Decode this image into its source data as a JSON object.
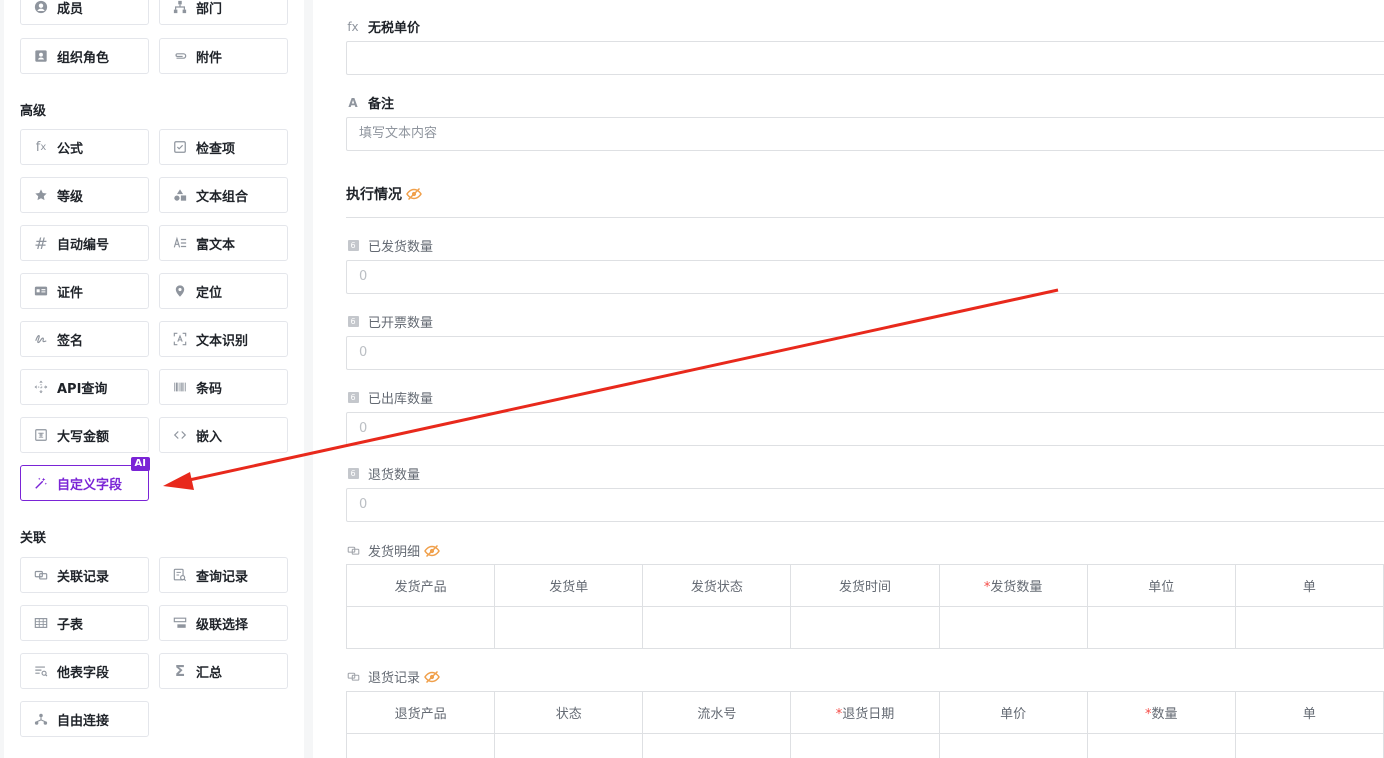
{
  "palette": {
    "top_fields": [
      {
        "label": "成员",
        "icon": "user-circle-icon"
      },
      {
        "label": "部门",
        "icon": "org-tree-icon"
      },
      {
        "label": "组织角色",
        "icon": "role-card-icon"
      },
      {
        "label": "附件",
        "icon": "paperclip-icon"
      }
    ],
    "advanced": {
      "title": "高级",
      "fields": [
        {
          "label": "公式",
          "icon": "fx-icon"
        },
        {
          "label": "检查项",
          "icon": "checkbox-icon"
        },
        {
          "label": "等级",
          "icon": "star-icon"
        },
        {
          "label": "文本组合",
          "icon": "shapes-icon"
        },
        {
          "label": "自动编号",
          "icon": "hash-icon"
        },
        {
          "label": "富文本",
          "icon": "rich-text-icon"
        },
        {
          "label": "证件",
          "icon": "id-card-icon"
        },
        {
          "label": "定位",
          "icon": "location-pin-icon"
        },
        {
          "label": "签名",
          "icon": "signature-icon"
        },
        {
          "label": "文本识别",
          "icon": "ocr-scan-icon"
        },
        {
          "label": "API查询",
          "icon": "api-move-icon"
        },
        {
          "label": "条码",
          "icon": "barcode-icon"
        },
        {
          "label": "大写金额",
          "icon": "currency-icon"
        },
        {
          "label": "嵌入",
          "icon": "code-brackets-icon"
        },
        {
          "label": "自定义字段",
          "icon": "magic-wand-icon",
          "badge": "AI"
        }
      ]
    },
    "relation": {
      "title": "关联",
      "fields": [
        {
          "label": "关联记录",
          "icon": "link-record-icon"
        },
        {
          "label": "查询记录",
          "icon": "query-record-icon"
        },
        {
          "label": "子表",
          "icon": "sub-table-icon"
        },
        {
          "label": "级联选择",
          "icon": "cascade-icon"
        },
        {
          "label": "他表字段",
          "icon": "other-table-field-icon"
        },
        {
          "label": "汇总",
          "icon": "sigma-icon"
        },
        {
          "label": "自由连接",
          "icon": "free-connect-icon"
        }
      ]
    }
  },
  "form": {
    "price_field": {
      "icon_text": "fx",
      "label": "无税单价",
      "value": ""
    },
    "note_field": {
      "icon_text": "A",
      "label": "备注",
      "placeholder": "填写文本内容"
    },
    "section": {
      "title": "执行情况"
    },
    "number_fields": [
      {
        "label": "已发货数量",
        "value": "0"
      },
      {
        "label": "已开票数量",
        "value": "0"
      },
      {
        "label": "已出库数量",
        "value": "0"
      },
      {
        "label": "退货数量",
        "value": "0"
      }
    ],
    "number_icon_text": "6",
    "shipping_table": {
      "label": "发货明细",
      "columns": [
        {
          "label": "发货产品",
          "required": false
        },
        {
          "label": "发货单",
          "required": false
        },
        {
          "label": "发货状态",
          "required": false
        },
        {
          "label": "发货时间",
          "required": false
        },
        {
          "label": "发货数量",
          "required": true
        },
        {
          "label": "单位",
          "required": false
        },
        {
          "label": "单",
          "required": false
        }
      ]
    },
    "return_table": {
      "label": "退货记录",
      "columns": [
        {
          "label": "退货产品",
          "required": false
        },
        {
          "label": "状态",
          "required": false
        },
        {
          "label": "流水号",
          "required": false
        },
        {
          "label": "退货日期",
          "required": true
        },
        {
          "label": "单价",
          "required": false
        },
        {
          "label": "数量",
          "required": true
        },
        {
          "label": "单",
          "required": false
        }
      ]
    },
    "required_mark": "*"
  },
  "colors": {
    "accent": "#7a24d6",
    "annotation_arrow": "#e8291c",
    "hidden_eye": "#f0a04b"
  }
}
